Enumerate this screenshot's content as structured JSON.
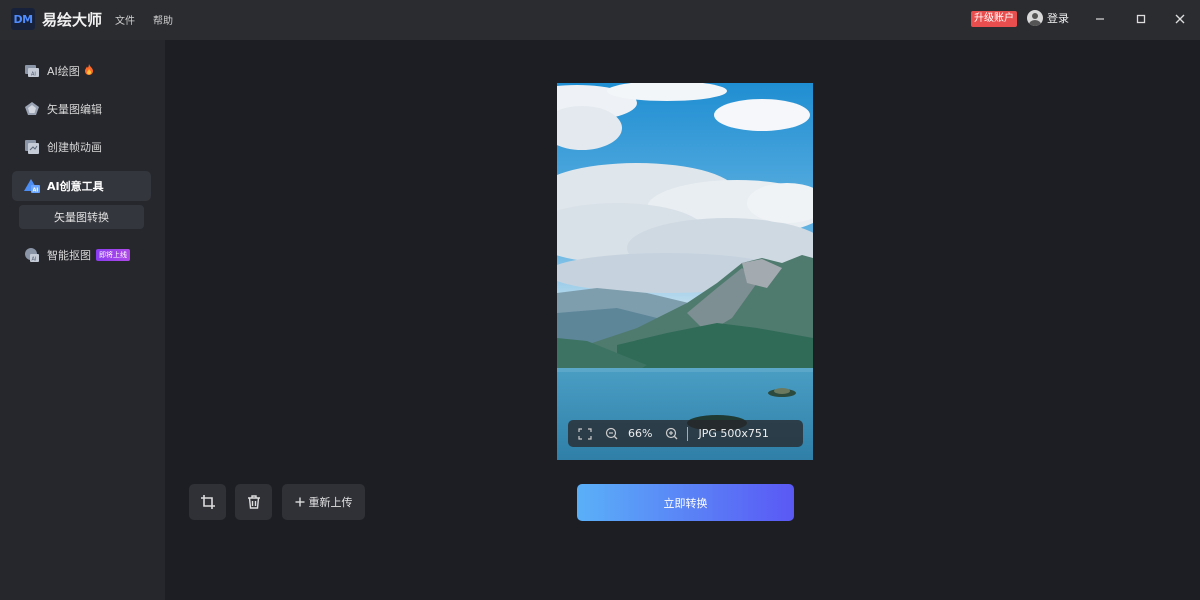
{
  "app": {
    "logo_text": "DM",
    "title": "易绘大师",
    "menu": [
      "文件",
      "帮助"
    ],
    "upgrade_label": "升级账户",
    "login_label": "登录"
  },
  "sidebar": {
    "items": [
      {
        "label": "AI绘图",
        "icon": "ai-draw-icon"
      },
      {
        "label": "矢量图编辑",
        "icon": "vector-edit-icon"
      },
      {
        "label": "创建帧动画",
        "icon": "frame-animation-icon"
      },
      {
        "label": "AI创意工具",
        "icon": "ai-creative-icon"
      },
      {
        "label": "智能抠图",
        "icon": "smart-cutout-icon",
        "badge": "即将上线"
      }
    ],
    "sub_item": "矢量图转换",
    "active": "AI创意工具"
  },
  "preview": {
    "zoom": "66%",
    "info": "JPG 500x751"
  },
  "actions": {
    "reupload_label": "重新上传",
    "convert_label": "立即转换"
  },
  "colors": {
    "accent_start": "#5ab0f8",
    "accent_end": "#5a58f5",
    "upgrade": "#e84e4e",
    "badge": "#8a3cf0"
  }
}
